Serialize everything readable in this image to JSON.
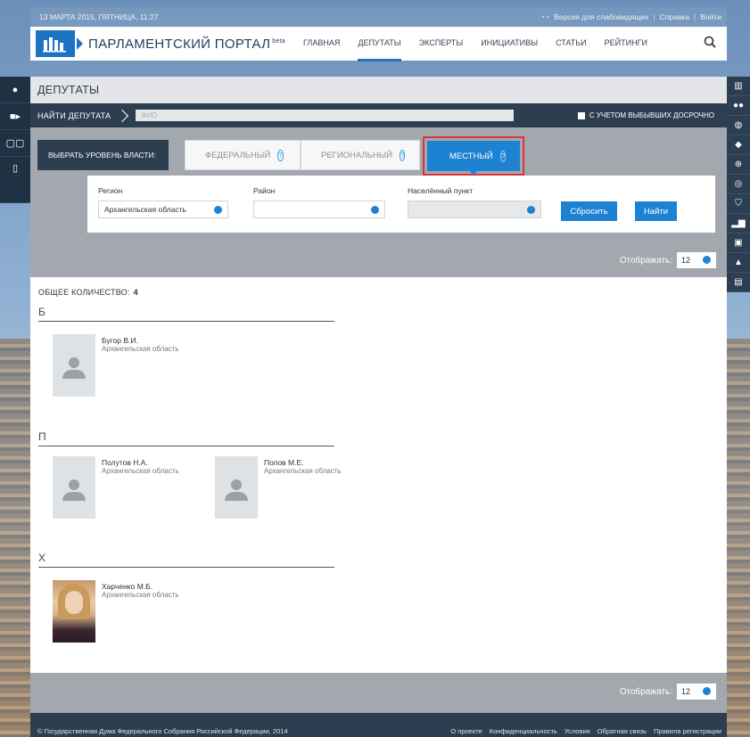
{
  "topbar": {
    "date": "13 МАРТА 2015, ПЯТНИЦА, 11:27",
    "eye_icon": "глаз",
    "accessibility": "Версия для слабовидящих",
    "sep": "|",
    "help": "Справка",
    "login": "Войти"
  },
  "nav": {
    "title": "ПАРЛАМЕНТСКИЙ ПОРТАЛ",
    "beta": "beta",
    "items": [
      "ГЛАВНАЯ",
      "ДЕПУТАТЫ",
      "ЭКСПЕРТЫ",
      "ИНИЦИАТИВЫ",
      "СТАТЬИ",
      "РЕЙТИНГИ"
    ],
    "active_index": 1,
    "search_icon": "⚲"
  },
  "page": {
    "title": "ДЕПУТАТЫ",
    "finder_label": "НАЙТИ ДЕПУТАТА",
    "fio_placeholder": "ФИО",
    "retired_checkbox": "С УЧЕТОМ ВЫБЫВШИХ ДОСРОЧНО"
  },
  "level": {
    "label": "ВЫБРАТЬ УРОВЕНЬ ВЛАСТИ:",
    "tabs": [
      "ФЕДЕРАЛЬНЫЙ",
      "РЕГИОНАЛЬНЫЙ",
      "МЕСТНЫЙ"
    ],
    "active_tab": "МЕСТНЫЙ",
    "help_glyph": "?"
  },
  "filters": {
    "region_label": "Регион",
    "region_value": "Архангельская область",
    "district_label": "Район",
    "district_value": "",
    "locality_label": "Населённый пункт",
    "locality_value": "",
    "reset_button": "Сбросить",
    "find_button": "Найти"
  },
  "paging": {
    "label": "Отображать:",
    "value": "12"
  },
  "results": {
    "total_label": "ОБЩЕЕ КОЛИЧЕСТВО:",
    "total_value": "4",
    "groups": [
      {
        "letter": "Б",
        "people": [
          {
            "name": "Бугор В.И.",
            "region": "Архангельская область"
          }
        ]
      },
      {
        "letter": "П",
        "people": [
          {
            "name": "Полутов Н.А.",
            "region": "Архангельская область"
          },
          {
            "name": "Попов М.Е.",
            "region": "Архангельская область"
          }
        ]
      },
      {
        "letter": "Х",
        "people": [
          {
            "name": "Харченко М.Б.",
            "region": "Архангельская область"
          }
        ]
      }
    ]
  },
  "footer": {
    "copyright": "© Государственная Дума Федерального Собрания Российской Федерации, 2014",
    "links": [
      "О проекте",
      "Конфиденциальность",
      "Условия",
      "Обратная связь",
      "Правила регистрации"
    ]
  },
  "side_left_icons": [
    "person-icon",
    "camera-icon",
    "book-icon",
    "phone-icon"
  ],
  "side_right_icons": [
    "building-icon",
    "group-icon",
    "pin-icon",
    "tag-icon",
    "globe-icon",
    "target-icon",
    "shield-icon",
    "chart-icon",
    "briefcase-icon",
    "tree-icon",
    "comment-icon"
  ],
  "colors": {
    "accent": "#1e82d2",
    "dark": "#2c3e50",
    "highlight": "#e0313a"
  }
}
